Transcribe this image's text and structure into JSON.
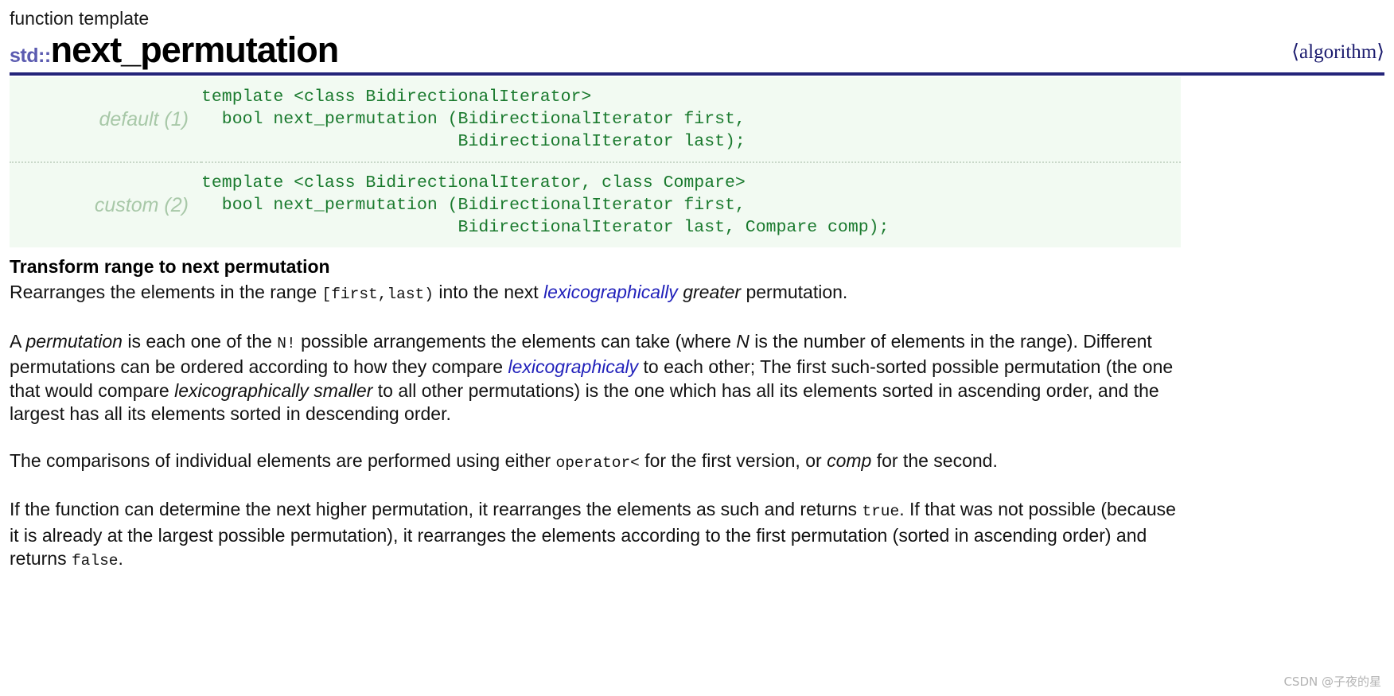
{
  "header": {
    "kicker": "function template",
    "namespace": "std::",
    "function_name": "next_permutation",
    "header_file": "⟨algorithm⟩"
  },
  "prototypes": [
    {
      "variant_label": "default (1)",
      "signature": "template <class BidirectionalIterator>\n  bool next_permutation (BidirectionalIterator first,\n                         BidirectionalIterator last);"
    },
    {
      "variant_label": "custom (2)",
      "signature": "template <class BidirectionalIterator, class Compare>\n  bool next_permutation (BidirectionalIterator first,\n                         BidirectionalIterator last, Compare comp);"
    }
  ],
  "section": {
    "title": "Transform range to next permutation"
  },
  "paragraphs": {
    "p1": {
      "t1": "Rearranges the elements in the range ",
      "code1": "[first,last)",
      "t2": " into the next ",
      "link1": "lexicographically",
      "t3": " ",
      "em1": "greater",
      "t4": " permutation."
    },
    "p2": {
      "t1": "A ",
      "em1": "permutation",
      "t2": " is each one of the ",
      "code1": "N!",
      "t3": " possible arrangements the elements can take (where ",
      "em2": "N",
      "t4": " is the number of elements in the range). Different permutations can be ordered according to how they compare ",
      "link1": "lexicographicaly",
      "t5": " to each other; The first such-sorted possible permutation (the one that would compare ",
      "em3": "lexicographically smaller",
      "t6": " to all other permutations) is the one which has all its elements sorted in ascending order, and the largest has all its elements sorted in descending order."
    },
    "p3": {
      "t1": "The comparisons of individual elements are performed using either ",
      "code1": "operator<",
      "t2": " for the first version, or ",
      "em1": "comp",
      "t3": " for the second."
    },
    "p4": {
      "t1": "If the function can determine the next higher permutation, it rearranges the elements as such and returns ",
      "code1": "true",
      "t2": ". If that was not possible (because it is already at the largest possible permutation), it rearranges the elements according to the first permutation (sorted in ascending order) and returns ",
      "code2": "false",
      "t3": "."
    }
  },
  "watermark": {
    "text": "CSDN @子夜的星"
  },
  "colors": {
    "rule": "#24247a",
    "namespace": "#5b5bb0",
    "code_green": "#1a7a2e",
    "link_blue": "#2222bb",
    "proto_bg": "#f2faf2",
    "variant_gray_green": "#a8c8a8"
  }
}
